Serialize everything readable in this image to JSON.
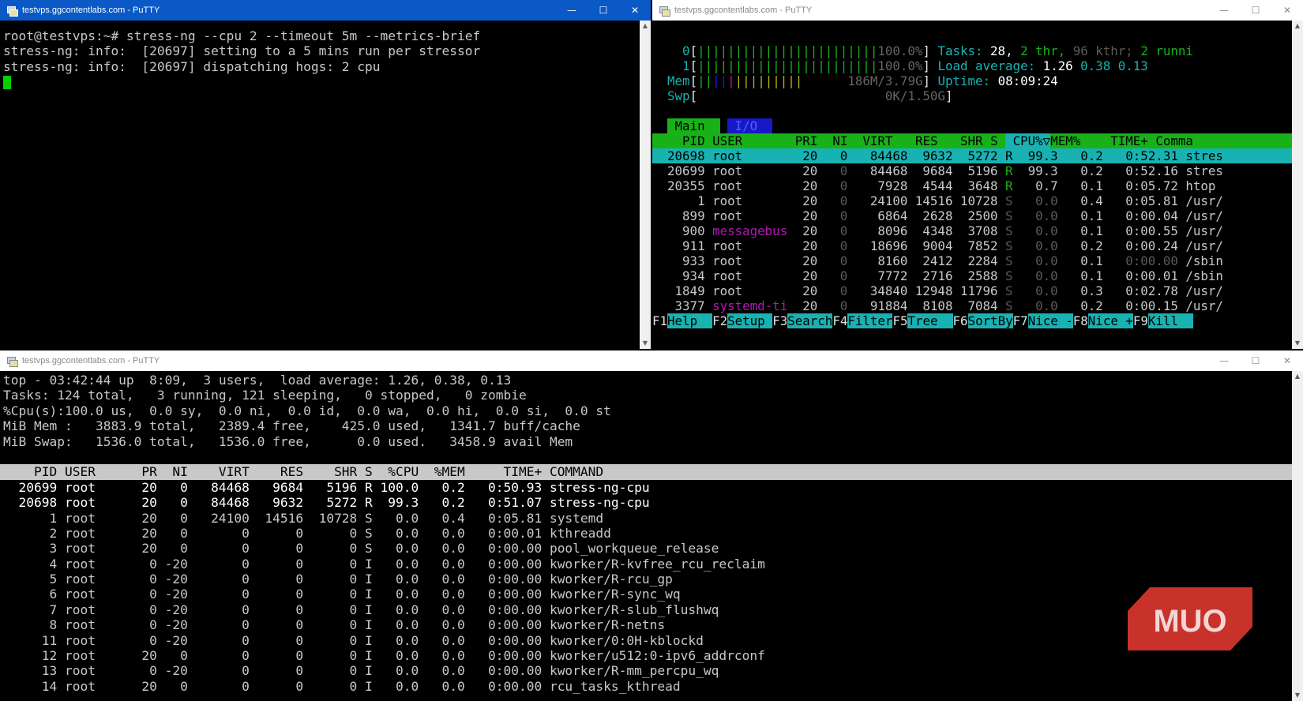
{
  "windows": {
    "top_left": {
      "title": "testvps.ggcontentlabs.com - PuTTY",
      "lines": [
        "root@testvps:~# stress-ng --cpu 2 --timeout 5m --metrics-brief",
        "stress-ng: info:  [20697] setting to a 5 mins run per stressor",
        "stress-ng: info:  [20697] dispatching hogs: 2 cpu"
      ]
    },
    "top_right": {
      "title": "testvps.ggcontentlabs.com - PuTTY",
      "meters": {
        "cpu0_label": "0",
        "cpu0_bar": "||||||||||||||||||||||||",
        "cpu0_value": "100.0%",
        "cpu1_label": "1",
        "cpu1_bar": "||||||||||||||||||||||||",
        "cpu1_value": "100.0%",
        "mem_label": "Mem",
        "mem_bar": "||||||||||||||",
        "mem_value": "186M/3.79G",
        "swp_label": "Swp",
        "swp_value": "0K/1.50G",
        "tasks_label": "Tasks:",
        "tasks_value": "28,",
        "thr_value": "2 thr,",
        "kthr_value": "96 kthr;",
        "running_value": "2 runni",
        "load_label": "Load average:",
        "load_1": "1.26",
        "load_5": "0.38",
        "load_15": "0.13",
        "uptime_label": "Uptime:",
        "uptime_value": "08:09:24"
      },
      "tabs": [
        "Main",
        "I/O"
      ],
      "columns": {
        "pid": "PID",
        "user": "USER",
        "pri": "PRI",
        "ni": "NI",
        "virt": "VIRT",
        "res": "RES",
        "shr": "SHR",
        "s": "S",
        "cpu": "CPU%▽",
        "mem": "MEM%",
        "time": "TIME+",
        "command": "Comma"
      },
      "rows": [
        {
          "pid": "20698",
          "user": "root",
          "pri": "20",
          "ni": "0",
          "virt": "84468",
          "res": "9632",
          "shr": "5272",
          "s": "R",
          "cpu": "99.3",
          "mem": "0.2",
          "time": "0:52.31",
          "cmd": "stres"
        },
        {
          "pid": "20699",
          "user": "root",
          "pri": "20",
          "ni": "0",
          "virt": "84468",
          "res": "9684",
          "shr": "5196",
          "s": "R",
          "cpu": "99.3",
          "mem": "0.2",
          "time": "0:52.16",
          "cmd": "stres"
        },
        {
          "pid": "20355",
          "user": "root",
          "pri": "20",
          "ni": "0",
          "virt": "7928",
          "res": "4544",
          "shr": "3648",
          "s": "R",
          "cpu": "0.7",
          "mem": "0.1",
          "time": "0:05.72",
          "cmd": "htop"
        },
        {
          "pid": "1",
          "user": "root",
          "pri": "20",
          "ni": "0",
          "virt": "24100",
          "res": "14516",
          "shr": "10728",
          "s": "S",
          "cpu": "0.0",
          "mem": "0.4",
          "time": "0:05.81",
          "cmd": "/usr/"
        },
        {
          "pid": "899",
          "user": "root",
          "pri": "20",
          "ni": "0",
          "virt": "6864",
          "res": "2628",
          "shr": "2500",
          "s": "S",
          "cpu": "0.0",
          "mem": "0.1",
          "time": "0:00.04",
          "cmd": "/usr/"
        },
        {
          "pid": "900",
          "user": "messagebus",
          "pri": "20",
          "ni": "0",
          "virt": "8096",
          "res": "4348",
          "shr": "3708",
          "s": "S",
          "cpu": "0.0",
          "mem": "0.1",
          "time": "0:00.55",
          "cmd": "/usr/"
        },
        {
          "pid": "911",
          "user": "root",
          "pri": "20",
          "ni": "0",
          "virt": "18696",
          "res": "9004",
          "shr": "7852",
          "s": "S",
          "cpu": "0.0",
          "mem": "0.2",
          "time": "0:00.24",
          "cmd": "/usr/"
        },
        {
          "pid": "933",
          "user": "root",
          "pri": "20",
          "ni": "0",
          "virt": "8160",
          "res": "2412",
          "shr": "2284",
          "s": "S",
          "cpu": "0.0",
          "mem": "0.1",
          "time": "0:00.00",
          "cmd": "/sbin"
        },
        {
          "pid": "934",
          "user": "root",
          "pri": "20",
          "ni": "0",
          "virt": "7772",
          "res": "2716",
          "shr": "2588",
          "s": "S",
          "cpu": "0.0",
          "mem": "0.1",
          "time": "0:00.01",
          "cmd": "/sbin"
        },
        {
          "pid": "1849",
          "user": "root",
          "pri": "20",
          "ni": "0",
          "virt": "34840",
          "res": "12948",
          "shr": "11796",
          "s": "S",
          "cpu": "0.0",
          "mem": "0.3",
          "time": "0:02.78",
          "cmd": "/usr/"
        },
        {
          "pid": "3377",
          "user": "systemd-ti",
          "pri": "20",
          "ni": "0",
          "virt": "91884",
          "res": "8108",
          "shr": "7084",
          "s": "S",
          "cpu": "0.0",
          "mem": "0.2",
          "time": "0:00.15",
          "cmd": "/usr/"
        }
      ],
      "fkeys": [
        {
          "key": "F1",
          "label": "Help  "
        },
        {
          "key": "F2",
          "label": "Setup "
        },
        {
          "key": "F3",
          "label": "Search"
        },
        {
          "key": "F4",
          "label": "Filter"
        },
        {
          "key": "F5",
          "label": "Tree  "
        },
        {
          "key": "F6",
          "label": "SortBy"
        },
        {
          "key": "F7",
          "label": "Nice -"
        },
        {
          "key": "F8",
          "label": "Nice +"
        },
        {
          "key": "F9",
          "label": "Kill  "
        }
      ]
    },
    "bottom": {
      "title": "testvps.ggcontentlabs.com - PuTTY",
      "summary": [
        "top - 03:42:44 up  8:09,  3 users,  load average: 1.26, 0.38, 0.13",
        "Tasks: 124 total,   3 running, 121 sleeping,   0 stopped,   0 zombie",
        "%Cpu(s):100.0 us,  0.0 sy,  0.0 ni,  0.0 id,  0.0 wa,  0.0 hi,  0.0 si,  0.0 st",
        "MiB Mem :   3883.9 total,   2389.4 free,    425.0 used,   1341.7 buff/cache",
        "MiB Swap:   1536.0 total,   1536.0 free,      0.0 used.   3458.9 avail Mem"
      ],
      "header": "    PID USER      PR  NI    VIRT    RES    SHR S  %CPU  %MEM     TIME+ COMMAND",
      "rows": [
        "  20699 root      20   0   84468   9684   5196 R 100.0   0.2   0:50.93 stress-ng-cpu",
        "  20698 root      20   0   84468   9632   5272 R  99.3   0.2   0:51.07 stress-ng-cpu",
        "      1 root      20   0   24100  14516  10728 S   0.0   0.4   0:05.81 systemd",
        "      2 root      20   0       0      0      0 S   0.0   0.0   0:00.01 kthreadd",
        "      3 root      20   0       0      0      0 S   0.0   0.0   0:00.00 pool_workqueue_release",
        "      4 root       0 -20       0      0      0 I   0.0   0.0   0:00.00 kworker/R-kvfree_rcu_reclaim",
        "      5 root       0 -20       0      0      0 I   0.0   0.0   0:00.00 kworker/R-rcu_gp",
        "      6 root       0 -20       0      0      0 I   0.0   0.0   0:00.00 kworker/R-sync_wq",
        "      7 root       0 -20       0      0      0 I   0.0   0.0   0:00.00 kworker/R-slub_flushwq",
        "      8 root       0 -20       0      0      0 I   0.0   0.0   0:00.00 kworker/R-netns",
        "     11 root       0 -20       0      0      0 I   0.0   0.0   0:00.00 kworker/0:0H-kblockd",
        "     12 root      20   0       0      0      0 I   0.0   0.0   0:00.00 kworker/u512:0-ipv6_addrconf",
        "     13 root       0 -20       0      0      0 I   0.0   0.0   0:00.00 kworker/R-mm_percpu_wq",
        "     14 root      20   0       0      0      0 I   0.0   0.0   0:00.00 rcu_tasks_kthread"
      ]
    }
  },
  "watermark": {
    "text": "MUO",
    "color": "#c8322a"
  },
  "colors": {
    "titlebar_active": "#0a59c7",
    "cursor": "#00d000",
    "htop_green": "#18b218",
    "htop_cyan": "#18b2b2"
  }
}
